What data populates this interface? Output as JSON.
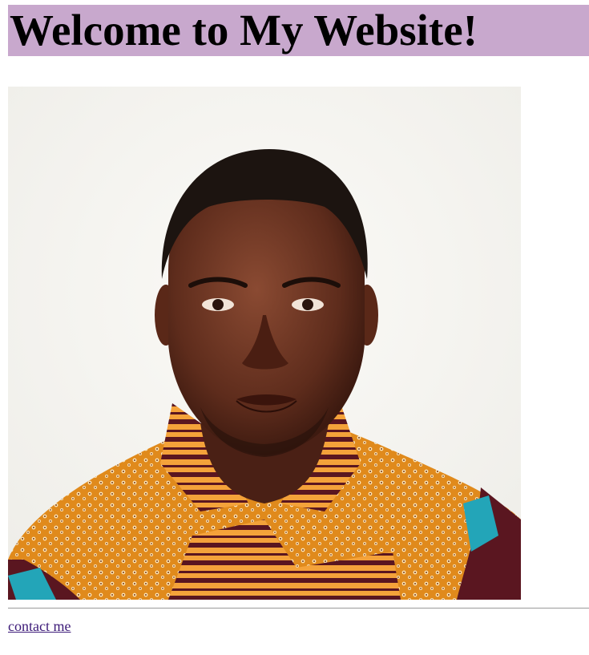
{
  "header": {
    "title": "Welcome to My Website!",
    "background_color": "#c8a8cd"
  },
  "main": {
    "portrait": {
      "icon": "person-portrait-image"
    }
  },
  "footer": {
    "contact_link_label": "contact me",
    "link_color": "#3c1a78"
  }
}
